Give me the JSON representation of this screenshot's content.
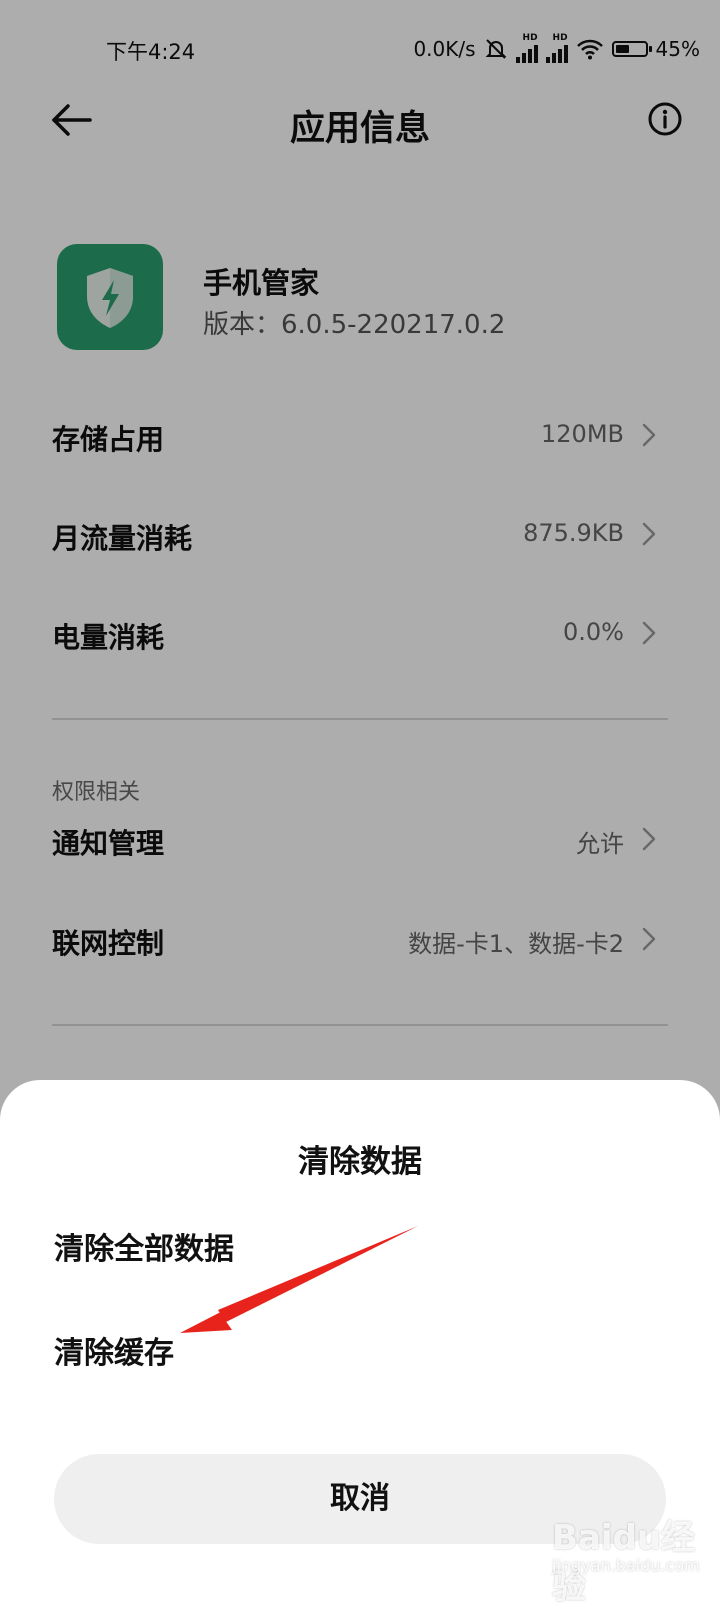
{
  "status_bar": {
    "time": "下午4:24",
    "network_speed": "0.0K/s",
    "signal_badges": [
      "HD",
      "HD"
    ],
    "battery": "45%",
    "battery_level": 0.45
  },
  "header": {
    "title": "应用信息",
    "back_icon": "arrow-left-icon",
    "info_icon": "info-icon"
  },
  "app": {
    "name": "手机管家",
    "version": "版本：6.0.5-220217.0.2",
    "icon_color": "#2A9E6F"
  },
  "rows": [
    {
      "label": "存储占用",
      "value": "120MB"
    },
    {
      "label": "月流量消耗",
      "value": "875.9KB"
    },
    {
      "label": "电量消耗",
      "value": "0.0%"
    }
  ],
  "permissions": {
    "section_title": "权限相关",
    "rows": [
      {
        "label": "通知管理",
        "value": "允许"
      },
      {
        "label": "联网控制",
        "value": "数据-卡1、数据-卡2"
      }
    ]
  },
  "sheet": {
    "title": "清除数据",
    "items": [
      "清除全部数据",
      "清除缓存"
    ],
    "cancel_label": "取消"
  },
  "annotation": {
    "arrow_color": "#E8231C"
  },
  "watermark": {
    "logo": "Baidu经验",
    "sub": "jingyan.baidu.com"
  }
}
